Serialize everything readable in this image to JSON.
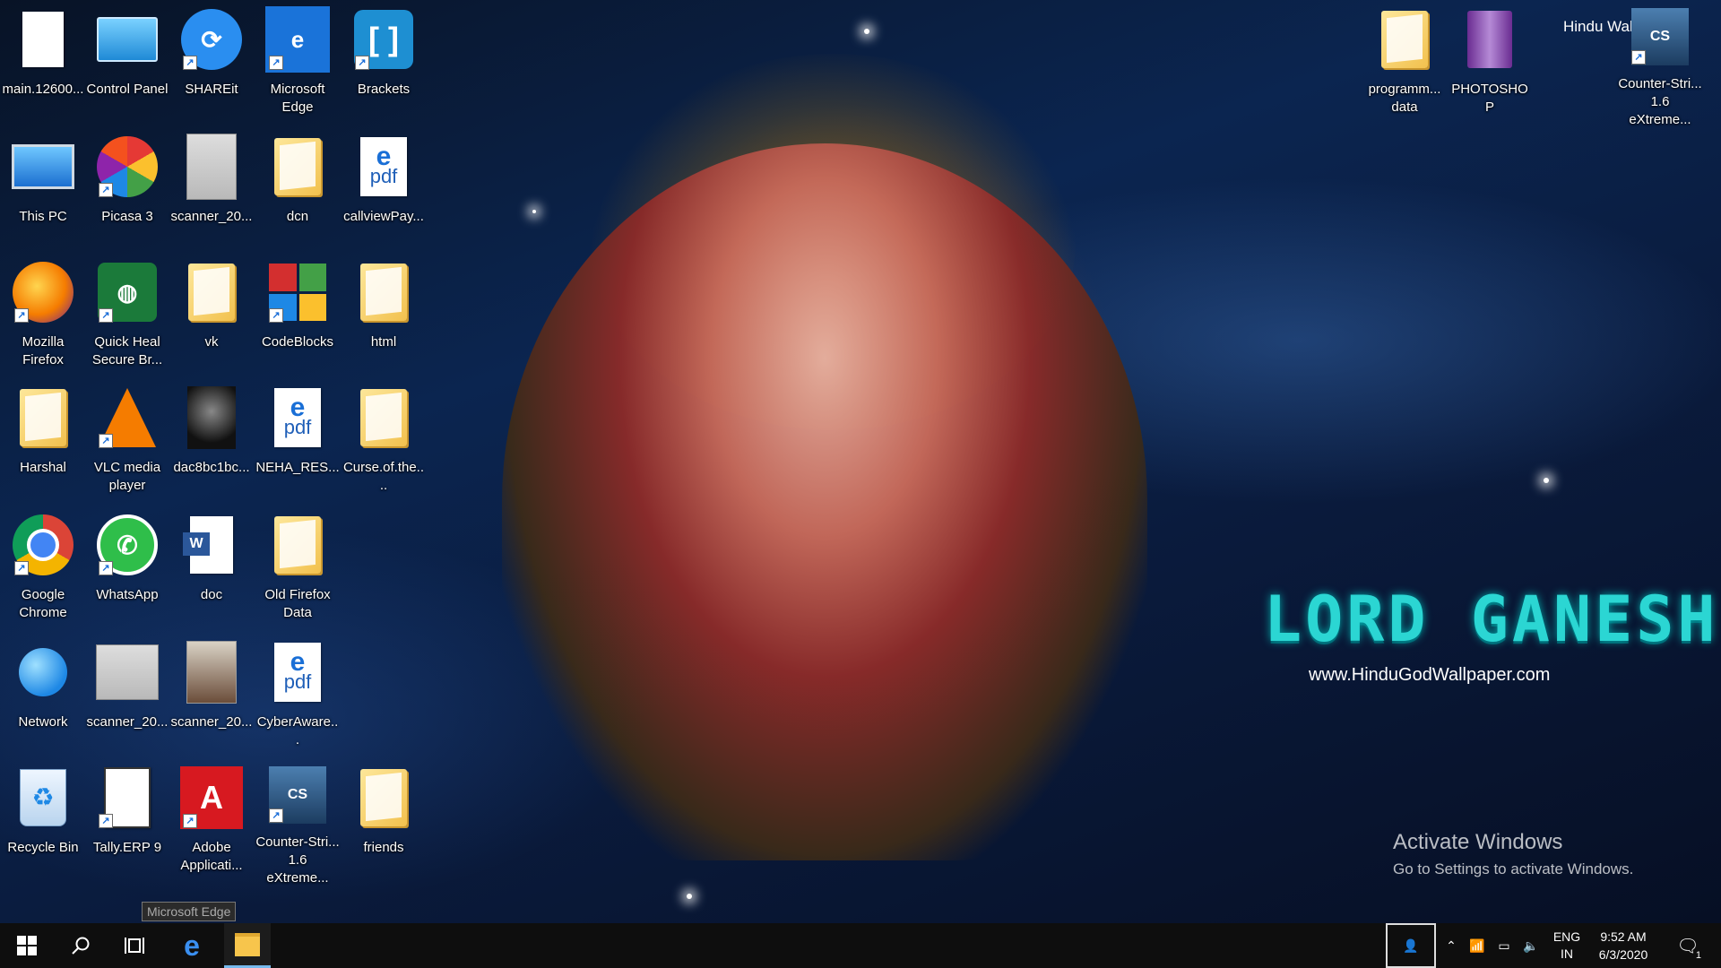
{
  "desktop": {
    "icons": [
      {
        "label": "main.12600...",
        "icon": "blank-file-icon"
      },
      {
        "label": "Control Panel",
        "icon": "control-panel-icon"
      },
      {
        "label": "SHAREit",
        "icon": "shareit-icon"
      },
      {
        "label": "Microsoft Edge",
        "icon": "edge-icon"
      },
      {
        "label": "Brackets",
        "icon": "brackets-icon"
      },
      {
        "label": "This PC",
        "icon": "computer-icon"
      },
      {
        "label": "Picasa 3",
        "icon": "picasa-icon"
      },
      {
        "label": "scanner_20...",
        "icon": "scanned-document-icon"
      },
      {
        "label": "dcn",
        "icon": "folder-icon"
      },
      {
        "label": "callviewPay...",
        "icon": "pdf-icon"
      },
      {
        "label": "Mozilla Firefox",
        "icon": "firefox-icon"
      },
      {
        "label": "Quick Heal Secure Br...",
        "icon": "quick-heal-icon"
      },
      {
        "label": "vk",
        "icon": "folder-icon"
      },
      {
        "label": "CodeBlocks",
        "icon": "codeblocks-icon"
      },
      {
        "label": "html",
        "icon": "folder-icon"
      },
      {
        "label": "Harshal",
        "icon": "user-folder-icon"
      },
      {
        "label": "VLC media player",
        "icon": "vlc-icon"
      },
      {
        "label": "dac8bc1bc...",
        "icon": "image-icon"
      },
      {
        "label": "NEHA_RES...",
        "icon": "pdf-icon"
      },
      {
        "label": "Curse.of.the....",
        "icon": "folder-icon"
      },
      {
        "label": "Google Chrome",
        "icon": "chrome-icon"
      },
      {
        "label": "WhatsApp",
        "icon": "whatsapp-icon"
      },
      {
        "label": "doc",
        "icon": "word-document-icon"
      },
      {
        "label": "Old Firefox Data",
        "icon": "folder-icon"
      },
      {
        "label": "Network",
        "icon": "network-icon"
      },
      {
        "label": "scanner_20...",
        "icon": "scanned-id-card-icon"
      },
      {
        "label": "scanner_20...",
        "icon": "photo-icon"
      },
      {
        "label": "CyberAware...",
        "icon": "pdf-icon"
      },
      {
        "label": "Recycle Bin",
        "icon": "recycle-bin-icon"
      },
      {
        "label": "Tally.ERP 9",
        "icon": "tally-icon"
      },
      {
        "label": "Adobe Applicati...",
        "icon": "adobe-icon"
      },
      {
        "label": "Counter-Stri... 1.6 eXtreme...",
        "icon": "counter-strike-icon"
      },
      {
        "label": "friends",
        "icon": "folder-icon"
      }
    ],
    "right_icons": [
      {
        "label": "programm... data",
        "icon": "folder-icon"
      },
      {
        "label": "PHOTOSHOP",
        "icon": "rar-archive-icon"
      },
      {
        "label": "Counter-Stri... 1.6 eXtreme...",
        "icon": "counter-strike-icon"
      }
    ]
  },
  "wallpaper": {
    "title": "LORD GANESH",
    "site": "www.HinduGodWallpaper.com",
    "logo_text": "Hindu Wallp"
  },
  "watermark": {
    "line1": "Activate Windows",
    "line2": "Go to Settings to activate Windows."
  },
  "tooltip": "Microsoft Edge",
  "taskbar": {
    "language": "ENG",
    "region": "IN",
    "time": "9:52 AM",
    "date": "6/3/2020",
    "notification_count": "1"
  },
  "colors": {
    "taskbar_bg": "#0e0e0e",
    "title_color": "#2bd6d3",
    "edge_blue": "#1a73d9",
    "explorer_underline": "#76b9ed"
  }
}
